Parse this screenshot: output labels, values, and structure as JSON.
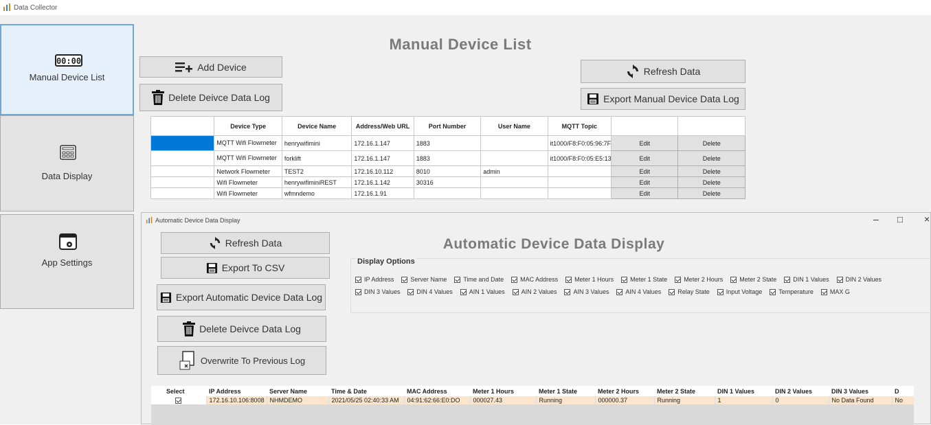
{
  "main_window": {
    "title": "Data Collector"
  },
  "sidebar": {
    "items": [
      {
        "label": "Manual Device List",
        "icon": "clock-display-icon",
        "selected": true
      },
      {
        "label": "Data Display",
        "icon": "keypad-display-icon",
        "selected": false
      },
      {
        "label": "App Settings",
        "icon": "window-gear-icon",
        "selected": false
      }
    ]
  },
  "manual": {
    "title": "Manual Device List",
    "buttons": {
      "add_device": "Add Device",
      "delete_log": "Delete Deivce Data Log",
      "refresh": "Refresh Data",
      "export": "Export Manual Device Data Log"
    },
    "table": {
      "headers": [
        "",
        "Device Type",
        "Device Name",
        "Address/Web URL",
        "Port Number",
        "User Name",
        "MQTT Topic",
        "",
        ""
      ],
      "rows": [
        {
          "type": "MQTT Wifi Flowmeter",
          "name": "henrywifimini",
          "address": "172.16.1.147",
          "port": "1883",
          "user": "",
          "topic": "it1000/F8:F0:05:96:7F",
          "edit": "Edit",
          "delete": "Delete"
        },
        {
          "type": "MQTT Wifi Flowmeter",
          "name": "forklift",
          "address": "172.16.1.147",
          "port": "1883",
          "user": "",
          "topic": "it1000/F8:F0:05:E5:13",
          "edit": "Edit",
          "delete": "Delete"
        },
        {
          "type": "Network Flowmeter",
          "name": "TEST2",
          "address": "172.16.10.112",
          "port": "8010",
          "user": "admin",
          "topic": "",
          "edit": "Edit",
          "delete": "Delete"
        },
        {
          "type": "Wifi Flowmeter",
          "name": "henrywifiminiREST",
          "address": "172.16.1.142",
          "port": "30316",
          "user": "",
          "topic": "",
          "edit": "Edit",
          "delete": "Delete"
        },
        {
          "type": "Wifi Flowmeter",
          "name": "wfmndemo",
          "address": "172.16.1.91",
          "port": "",
          "user": "",
          "topic": "",
          "edit": "Edit",
          "delete": "Delete"
        }
      ]
    }
  },
  "auto_dialog": {
    "title": "Automatic Device Data Display",
    "heading": "Automatic Device Data Display",
    "window_controls": {
      "minimize": "–",
      "maximize": "□",
      "close": "×"
    },
    "buttons": {
      "refresh": "Refresh Data",
      "export_csv": "Export To CSV",
      "export_log": "Export Automatic Device Data Log",
      "delete_log": "Delete Deivce Data Log",
      "overwrite": "Overwrite To Previous Log"
    },
    "display_options": {
      "title": "Display Options",
      "row1": [
        "IP Address",
        "Server Name",
        "Time and Date",
        "MAC Address",
        "Meter 1 Hours",
        "Meter 1 State",
        "Meter 2 Hours",
        "Meter 2 State",
        "DIN 1 Values",
        "DIN 2 Values"
      ],
      "row2": [
        "DIN 3 Values",
        "DIN 4 Values",
        "AIN 1 Values",
        "AIN 2 Values",
        "AIN 3 Values",
        "AIN 4 Values",
        "Relay State",
        "Input Voltage",
        "Temperature",
        "MAX G"
      ]
    },
    "results": {
      "headers": [
        "Select",
        "IP Address",
        "Server Name",
        "Time & Date",
        "MAC Address",
        "Meter 1 Hours",
        "Meter 1 State",
        "Meter 2 Hours",
        "Meter 2 State",
        "DIN 1 Values",
        "DIN 2 Values",
        "DIN 3 Values",
        "D"
      ],
      "row": [
        "",
        "172.16.10.106:8008",
        "NHMDEMO",
        "2021/05/25 02:40:33 AM",
        "04:91:62:66:E0:DO",
        "000027.43",
        "Running",
        "000000.37",
        "Running",
        "1",
        "0",
        "No Data Found",
        "No"
      ]
    }
  },
  "colors": {
    "selected_blue": "#0078d7",
    "highlight_row": "#fce5cd",
    "nav_selected": "#e6f0fb"
  }
}
